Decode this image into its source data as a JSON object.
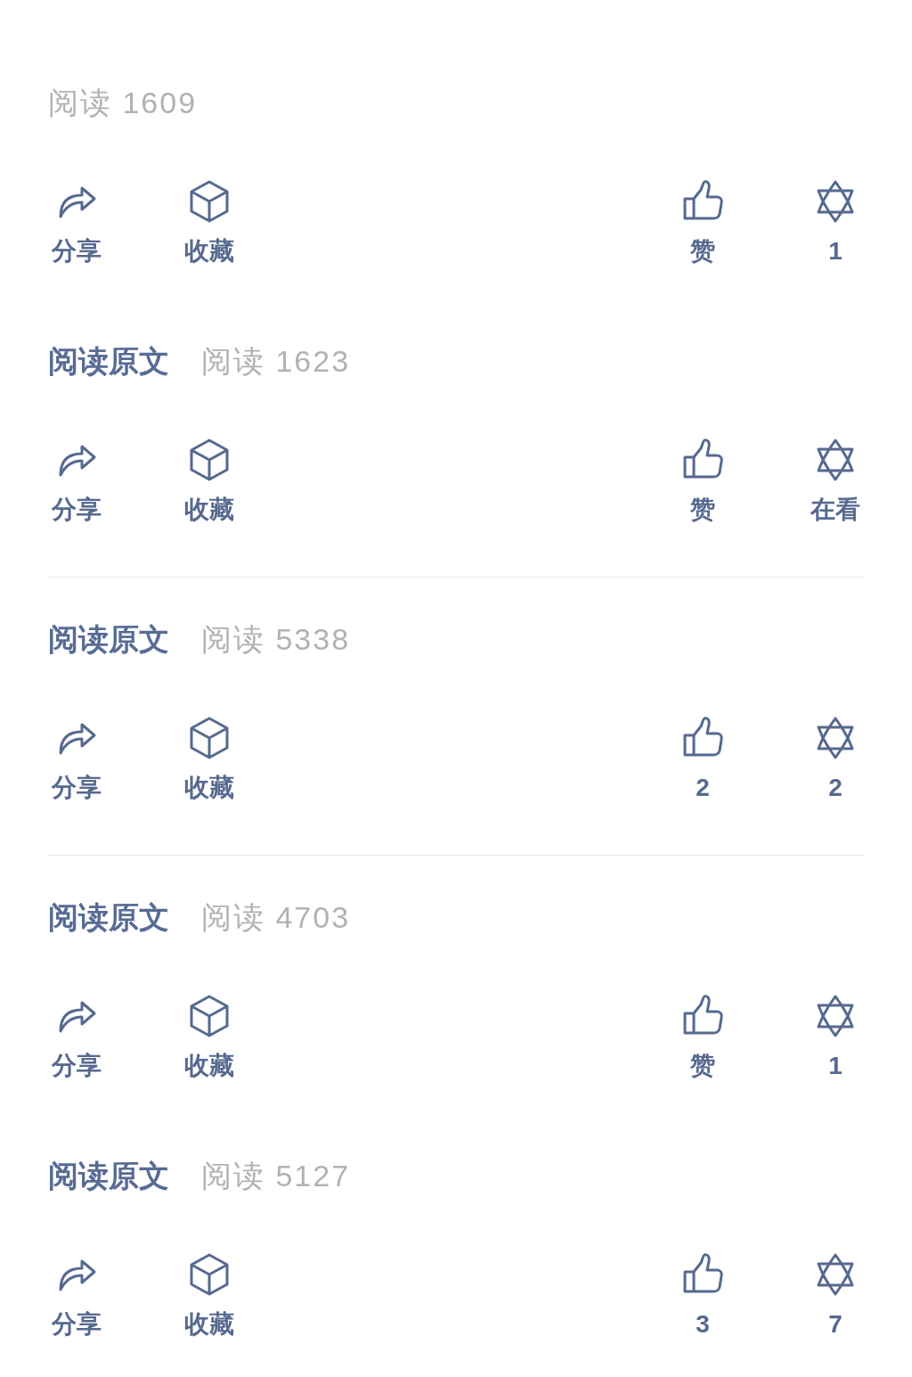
{
  "posts": [
    {
      "reads": "阅读 1609",
      "divider": false,
      "actions": [
        {
          "kind": "share",
          "label": "分享"
        },
        {
          "kind": "collect",
          "label": "收藏"
        },
        {
          "kind": "like",
          "label": "赞"
        },
        {
          "kind": "watch",
          "label": "1"
        }
      ]
    },
    {
      "link": "阅读原文",
      "reads": "阅读 1623",
      "divider": true,
      "actions": [
        {
          "kind": "share",
          "label": "分享"
        },
        {
          "kind": "collect",
          "label": "收藏"
        },
        {
          "kind": "like",
          "label": "赞"
        },
        {
          "kind": "watch",
          "label": "在看"
        }
      ]
    },
    {
      "link": "阅读原文",
      "reads": "阅读 5338",
      "divider": true,
      "actions": [
        {
          "kind": "share",
          "label": "分享"
        },
        {
          "kind": "collect",
          "label": "收藏"
        },
        {
          "kind": "like",
          "label": "2"
        },
        {
          "kind": "watch",
          "label": "2"
        }
      ]
    },
    {
      "link": "阅读原文",
      "reads": "阅读 4703",
      "divider": false,
      "actions": [
        {
          "kind": "share",
          "label": "分享"
        },
        {
          "kind": "collect",
          "label": "收藏"
        },
        {
          "kind": "like",
          "label": "赞"
        },
        {
          "kind": "watch",
          "label": "1"
        }
      ]
    },
    {
      "link": "阅读原文",
      "reads": "阅读 5127",
      "divider": false,
      "actions": [
        {
          "kind": "share",
          "label": "分享"
        },
        {
          "kind": "collect",
          "label": "收藏"
        },
        {
          "kind": "like",
          "label": "3"
        },
        {
          "kind": "watch",
          "label": "7"
        }
      ]
    }
  ]
}
